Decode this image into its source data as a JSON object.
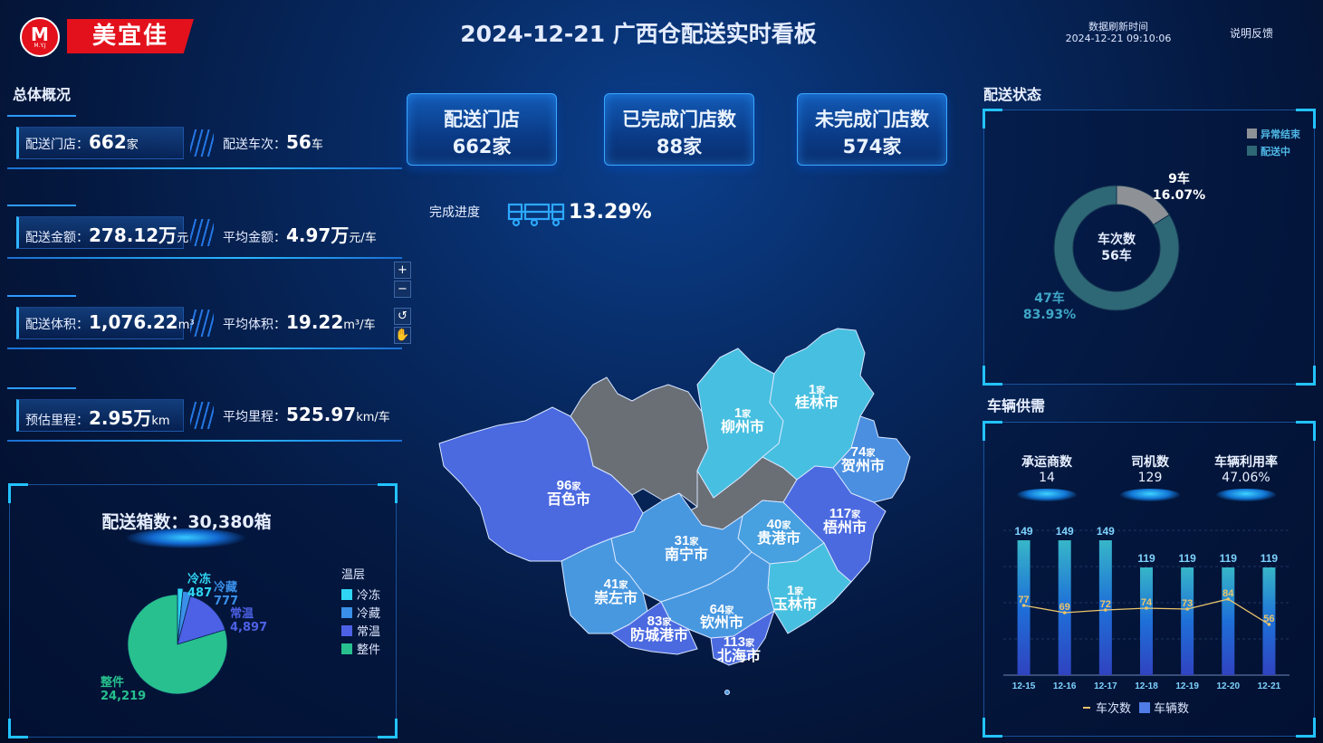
{
  "header": {
    "logo_mark": "M",
    "logo_sub": "M.Y.J",
    "brand": "美宜佳",
    "title": "2024-12-21  广西仓配送实时看板",
    "refresh_label": "数据刷新时间",
    "refresh_time": "2024-12-21 09:10:06",
    "feedback": "说明反馈"
  },
  "overview": {
    "title": "总体概况",
    "rows": [
      {
        "left_label": "配送门店：",
        "left_value": "662",
        "left_unit": "家",
        "right_label": "配送车次：",
        "right_value": "56",
        "right_unit": "车"
      },
      {
        "left_label": "配送金额：",
        "left_value": "278.12万",
        "left_unit": "元",
        "right_label": "平均金额：",
        "right_value": "4.97万",
        "right_unit": "元/车"
      },
      {
        "left_label": "配送体积：",
        "left_value": "1,076.22",
        "left_unit": "m³",
        "right_label": "平均体积：",
        "right_value": "19.22",
        "right_unit": "m³/车"
      },
      {
        "left_label": "预估里程：",
        "left_value": "2.95万",
        "left_unit": "km",
        "right_label": "平均里程：",
        "right_value": "525.97",
        "right_unit": "km/车"
      }
    ]
  },
  "boxes": {
    "title": "配送箱数：30,380箱",
    "legend_title": "温层",
    "colors": [
      "#2fd5f3",
      "#3a8fe8",
      "#4d61e6",
      "#27c08e"
    ]
  },
  "cards": [
    {
      "title": "配送门店",
      "value": "662家"
    },
    {
      "title": "已完成门店数",
      "value": "88家"
    },
    {
      "title": "未完成门店数",
      "value": "574家"
    }
  ],
  "progress": {
    "label": "完成进度",
    "value": "13.29%"
  },
  "map": {
    "zoom_in": "+",
    "zoom_out": "−",
    "regions": [
      {
        "name": "桂林市",
        "count": "1",
        "unit": "家"
      },
      {
        "name": "柳州市",
        "count": "1",
        "unit": "家"
      },
      {
        "name": "贺州市",
        "count": "74",
        "unit": "家"
      },
      {
        "name": "百色市",
        "count": "96",
        "unit": "家"
      },
      {
        "name": "梧州市",
        "count": "117",
        "unit": "家"
      },
      {
        "name": "贵港市",
        "count": "40",
        "unit": "家"
      },
      {
        "name": "南宁市",
        "count": "31",
        "unit": "家"
      },
      {
        "name": "崇左市",
        "count": "41",
        "unit": "家"
      },
      {
        "name": "玉林市",
        "count": "1",
        "unit": "家"
      },
      {
        "name": "钦州市",
        "count": "64",
        "unit": "家"
      },
      {
        "name": "防城港市",
        "count": "83",
        "unit": "家"
      },
      {
        "name": "北海市",
        "count": "113",
        "unit": "家"
      }
    ]
  },
  "delivery_status": {
    "title": "配送状态",
    "center_label": "车次数",
    "center_value": "56车",
    "legend": [
      {
        "name": "异常结束",
        "color": "#8e9296"
      },
      {
        "name": "配送中",
        "color": "#2e6775"
      }
    ],
    "slices": [
      {
        "label": "9车",
        "pct": "16.07%",
        "value": 9,
        "color": "#8e9296"
      },
      {
        "label": "47车",
        "pct": "83.93%",
        "value": 47,
        "color": "#2e6775"
      }
    ]
  },
  "vehicle": {
    "title": "车辆供需",
    "kpis": [
      {
        "label": "承运商数",
        "value": "14"
      },
      {
        "label": "司机数",
        "value": "129"
      },
      {
        "label": "车辆利用率",
        "value": "47.06%"
      }
    ],
    "legend_line": "车次数",
    "legend_bar": "车辆数"
  },
  "chart_data": [
    {
      "type": "pie",
      "categories": [
        "冷冻",
        "冷藏",
        "常温",
        "整件"
      ],
      "values": [
        487,
        777,
        4897,
        24219
      ],
      "value_labels": [
        "487",
        "777",
        "4,897",
        "24,219"
      ],
      "title": "配送箱数：30,380箱",
      "legend_title": "温层",
      "legend": "right"
    },
    {
      "type": "bar",
      "categories": [
        "12-15",
        "12-16",
        "12-17",
        "12-18",
        "12-19",
        "12-20",
        "12-21"
      ],
      "series": [
        {
          "name": "车辆数",
          "type": "bar",
          "values": [
            149,
            149,
            149,
            119,
            119,
            119,
            119
          ]
        },
        {
          "name": "车次数",
          "type": "line",
          "values": [
            77,
            69,
            72,
            74,
            73,
            84,
            56
          ]
        }
      ],
      "ylim": [
        0,
        160
      ],
      "legend": "bottom"
    }
  ]
}
